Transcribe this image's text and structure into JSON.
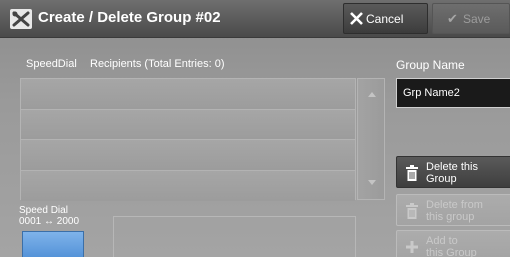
{
  "title": {
    "text": "Create / Delete Group #02",
    "icon": "tools-icon"
  },
  "toolbar": {
    "cancel_label": "Cancel",
    "save_label": "Save"
  },
  "list": {
    "header_speeddial": "SpeedDial",
    "header_recipients": "Recipients (Total Entries: 0)",
    "rows": [
      "",
      "",
      "",
      ""
    ]
  },
  "group_name": {
    "label": "Group Name",
    "value": "Grp Name2"
  },
  "actions": {
    "delete_group_line1": "Delete this",
    "delete_group_line2": "Group",
    "delete_from_line1": "Delete from",
    "delete_from_line2": "this group",
    "add_line1": "Add to",
    "add_line2": "this Group"
  },
  "speed_dial": {
    "label_line1": "Speed Dial",
    "label_line2": "0001 ↔ 2000"
  },
  "colors": {
    "title_bar": "#4a4a4a",
    "accent_blue": "#5b9be0",
    "field_bg": "#1a1a1a"
  }
}
